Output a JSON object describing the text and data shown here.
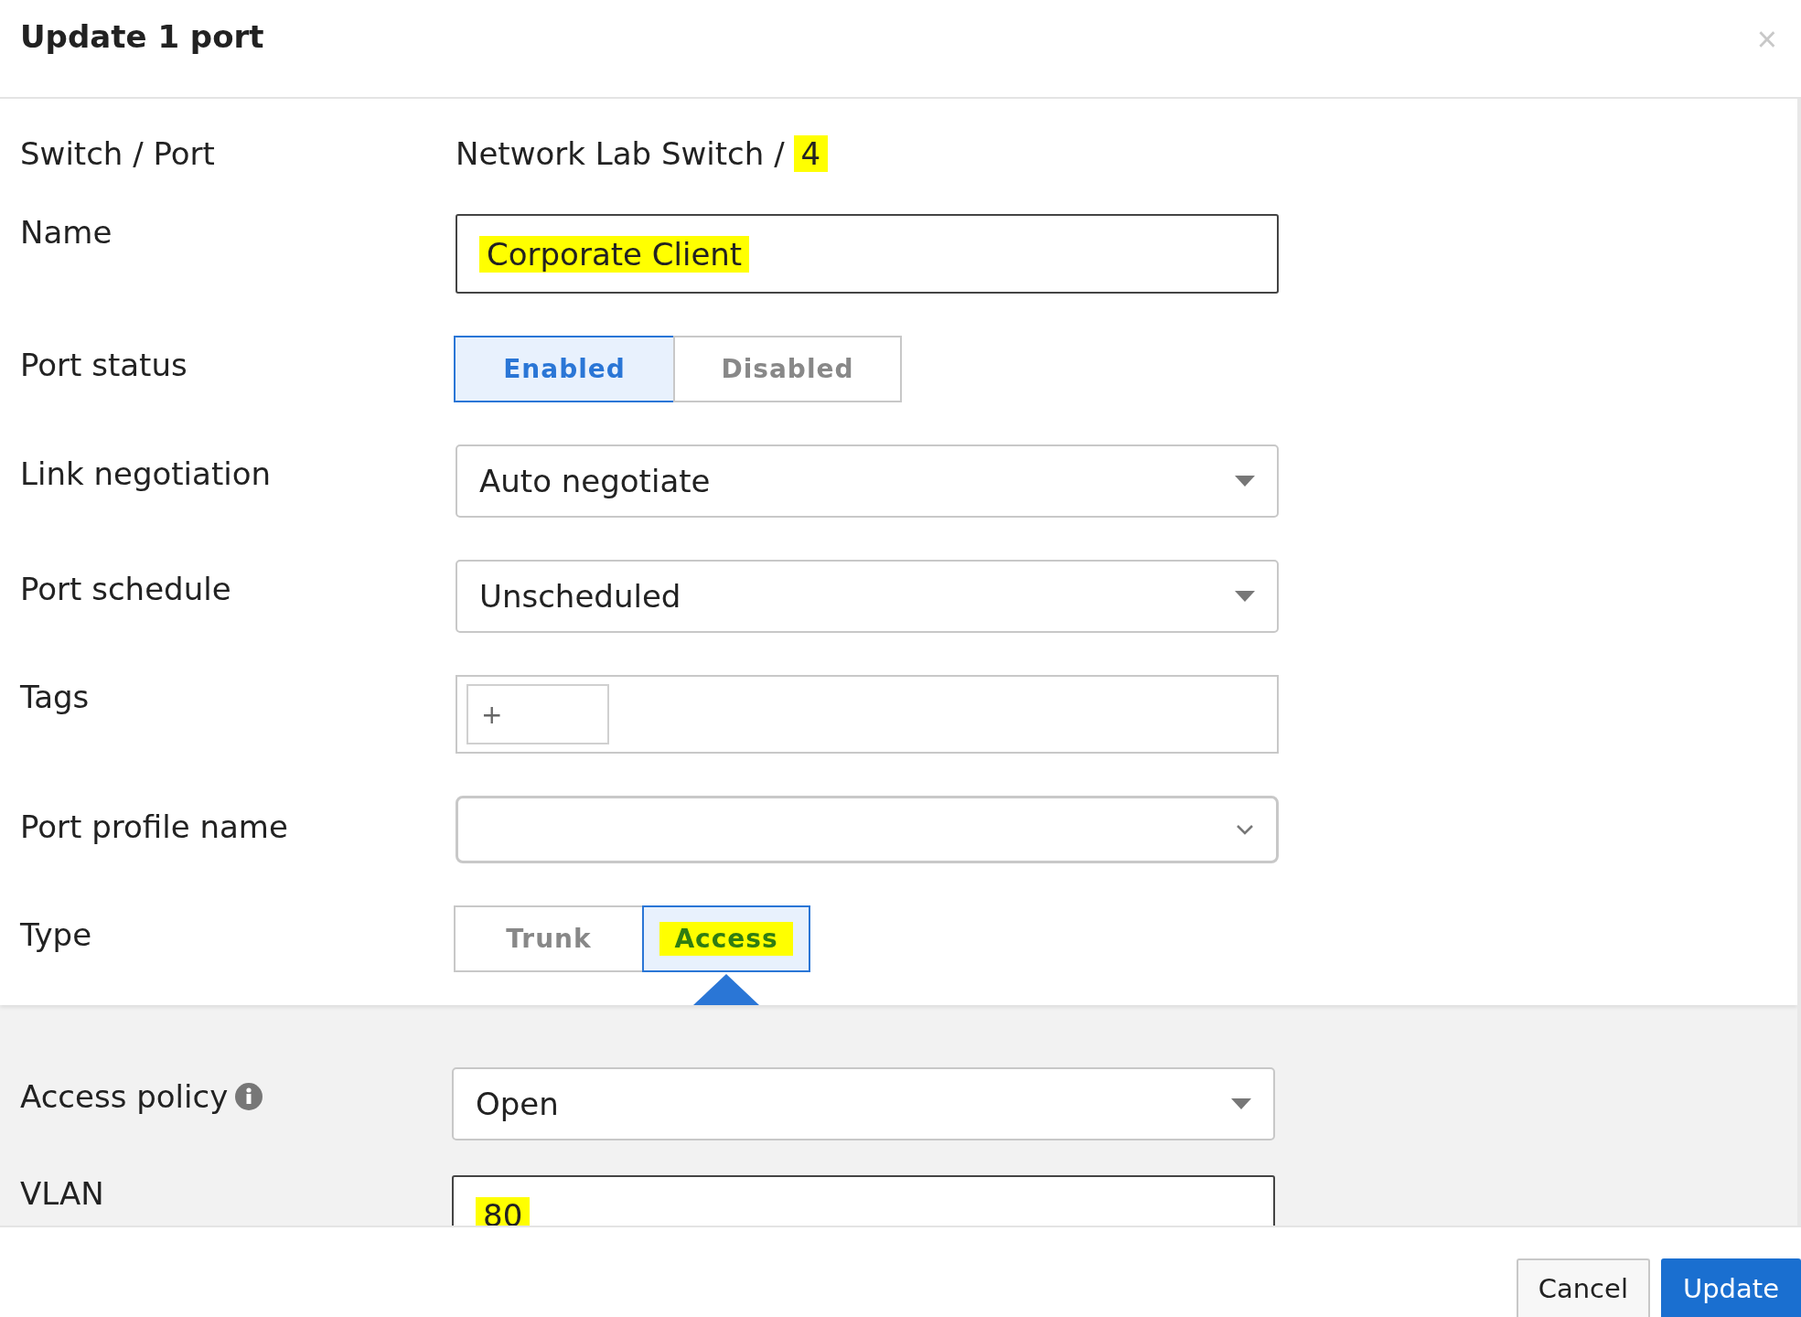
{
  "dialog": {
    "title": "Update 1 port",
    "close": "×"
  },
  "fields": [
    {
      "kind": "static",
      "label": "Switch / Port",
      "parts": [
        {
          "text": "Network Lab Switch /",
          "highlighted": false
        },
        {
          "text": "4",
          "highlighted": true
        }
      ]
    },
    {
      "kind": "text",
      "label": "Name",
      "value": "Corporate Client",
      "highlighted": true
    },
    {
      "kind": "segmented",
      "label": "Port status",
      "options": [
        {
          "label": "Enabled",
          "selected": true,
          "highlighted": false
        },
        {
          "label": "Disabled",
          "selected": false,
          "highlighted": false
        }
      ]
    },
    {
      "kind": "select",
      "label": "Link negotiation",
      "value": "Auto negotiate"
    },
    {
      "kind": "select",
      "label": "Port schedule",
      "value": "Unscheduled"
    },
    {
      "kind": "tags",
      "label": "Tags",
      "add": "+"
    },
    {
      "kind": "combo",
      "label": "Port profile name"
    },
    {
      "kind": "segmented",
      "label": "Type",
      "options": [
        {
          "label": "Trunk",
          "selected": false,
          "highlighted": false
        },
        {
          "label": "Access",
          "selected": true,
          "highlighted": true
        }
      ]
    }
  ],
  "access_section": {
    "fields": [
      {
        "kind": "select",
        "label": "Access policy",
        "info": true,
        "value": "Open"
      },
      {
        "kind": "text",
        "label": "VLAN",
        "value": "80",
        "highlighted": true
      }
    ]
  },
  "footer": {
    "buttons": [
      {
        "label": "Cancel",
        "kind": "secondary"
      },
      {
        "label": "Update",
        "kind": "primary"
      }
    ]
  }
}
